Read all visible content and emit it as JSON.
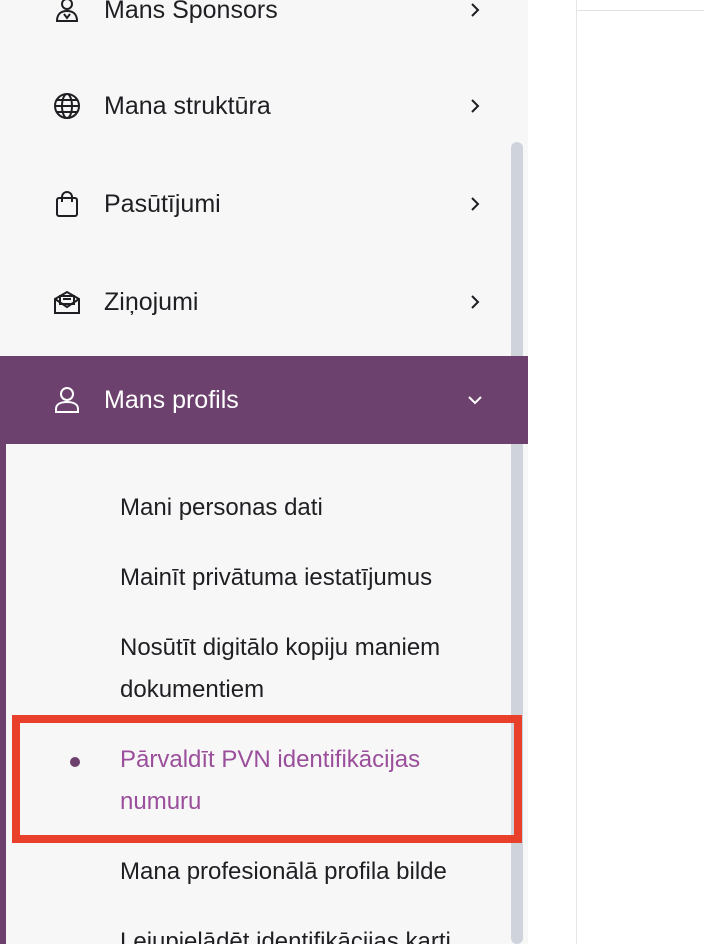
{
  "sidebar": {
    "items": [
      {
        "label": "Mans Sponsors",
        "icon": "sponsor-person-icon"
      },
      {
        "label": "Mana struktūra",
        "icon": "globe-icon"
      },
      {
        "label": "Pasūtījumi",
        "icon": "shopping-bag-icon"
      },
      {
        "label": "Ziņojumi",
        "icon": "message-envelope-icon"
      },
      {
        "label": "Mans profils",
        "icon": "user-icon",
        "expanded": true
      }
    ],
    "submenu": [
      {
        "label": "Mani personas dati"
      },
      {
        "label": "Mainīt privātuma iestatījumus"
      },
      {
        "label": "Nosūtīt digitālo kopiju maniem dokumentiem"
      },
      {
        "label": "Pārvaldīt PVN identifikācijas numuru",
        "current": true
      },
      {
        "label": "Mana profesionālā profila bilde"
      },
      {
        "label": "Lejupielādēt identifikācijas karti"
      }
    ]
  },
  "colors": {
    "active_bg": "#6c416d",
    "active_text": "#ffffff",
    "current_link": "#9a4e9b",
    "highlight_border": "#e8402a"
  }
}
